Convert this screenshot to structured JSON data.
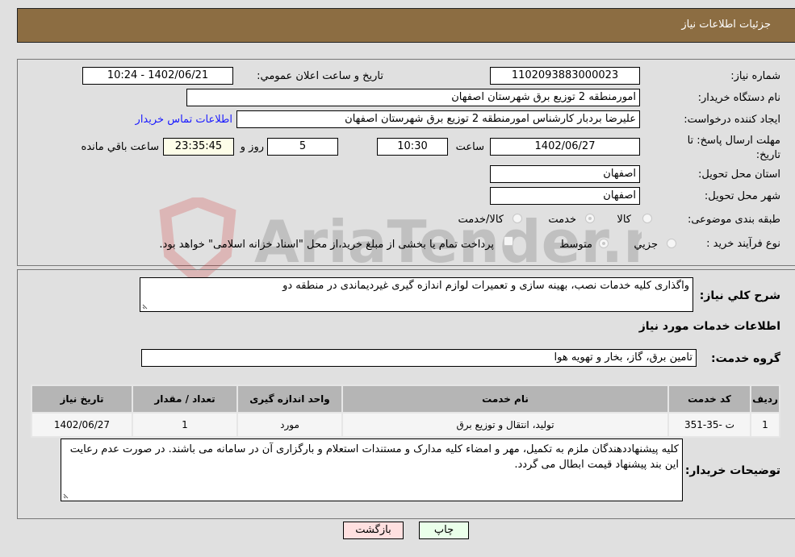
{
  "header": {
    "title": "جزئيات اطلاعات نياز"
  },
  "fields": {
    "need_number_label": "شماره نیاز:",
    "need_number": "1102093883000023",
    "announce_label": "تاریخ و ساعت اعلان عمومي:",
    "announce_value": "1402/06/21 - 10:24",
    "buyer_org_label": "نام دستگاه خریدار:",
    "buyer_org": "امورمنطقه 2 توزیع برق شهرستان اصفهان",
    "creator_label": "ایجاد کننده درخواست:",
    "creator": "علیرضا بردبار کارشناس امورمنطقه 2 توزیع برق شهرستان اصفهان",
    "contact_link": "اطلاعات تماس خریدار",
    "deadline_label": "مهلت ارسال پاسخ: تا تاریخ:",
    "deadline_date": "1402/06/27",
    "time_label": "ساعت",
    "deadline_time": "10:30",
    "days_value": "5",
    "days_label": "روز و",
    "remaining_time": "23:35:45",
    "remaining_label": "ساعت باقي مانده",
    "province_label": "استان محل تحویل:",
    "province": "اصفهان",
    "city_label": "شهر محل تحویل:",
    "city": "اصفهان",
    "category_label": "طبقه بندی موضوعی:",
    "category_options": [
      "کالا",
      "خدمت",
      "کالا/خدمت"
    ],
    "category_selected": "خدمت",
    "purchase_type_label": "نوع فرآیند خرید :",
    "purchase_options": [
      "جزيي",
      "متوسط"
    ],
    "purchase_selected": "متوسط",
    "treasury_note": "پرداخت تمام یا بخشی از مبلغ خرید،از محل \"اسناد خزانه اسلامی\" خواهد بود."
  },
  "description": {
    "label": "شرح كلي نياز:",
    "value": "واگذاری کلیه خدمات نصب، بهینه سازی و تعمیرات لوازم اندازه گیری غیردیماندی در منطقه دو"
  },
  "services": {
    "section_title": "اطلاعات خدمات مورد نياز",
    "group_label": "گروه خدمت:",
    "group_value": "تامین برق، گاز، بخار و تهویه هوا",
    "columns": [
      "رديف",
      "كد خدمت",
      "نام خدمت",
      "واحد اندازه گيری",
      "تعداد / مقدار",
      "تاريخ نياز"
    ],
    "rows": [
      [
        "1",
        "ت -35-351",
        "تولید، انتقال و توزیع برق",
        "مورد",
        "1",
        "1402/06/27"
      ]
    ]
  },
  "buyer_notes": {
    "label": "توضيحات خريدار:",
    "value": "کلیه پیشنهاددهندگان ملزم به تکمیل، مهر و امضاء کلیه مدارک و مستندات استعلام و بارگزاری آن در سامانه می باشند. در صورت عدم رعایت این بند پیشنهاد قیمت ابطال می گردد."
  },
  "buttons": {
    "print": "چاپ",
    "back": "بازگشت"
  },
  "colors": {
    "header": "#8c6d42",
    "print_bg": "#eaffea",
    "back_bg": "#ffe0e0",
    "link": "#1a1aff"
  }
}
